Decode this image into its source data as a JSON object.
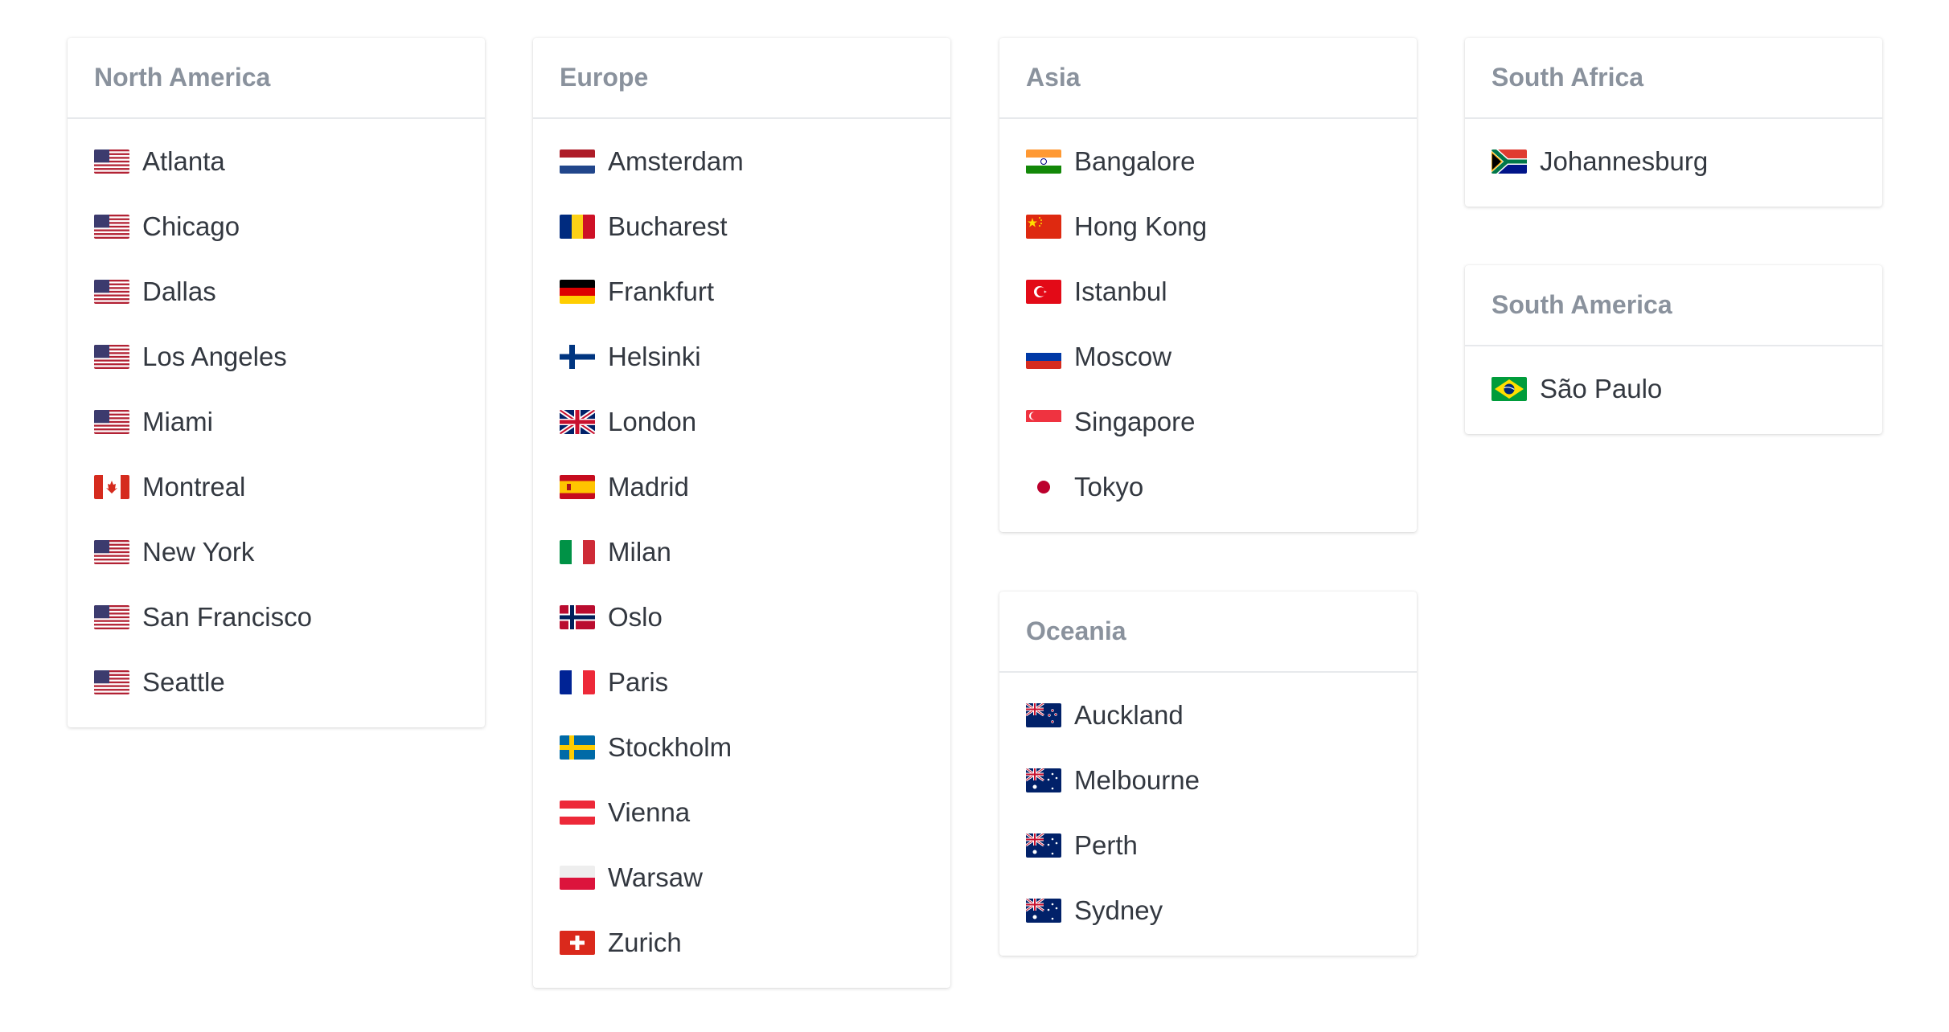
{
  "regions": [
    {
      "key": "north-america",
      "title": "North America",
      "locations": [
        {
          "name": "Atlanta",
          "flag": "us"
        },
        {
          "name": "Chicago",
          "flag": "us"
        },
        {
          "name": "Dallas",
          "flag": "us"
        },
        {
          "name": "Los Angeles",
          "flag": "us"
        },
        {
          "name": "Miami",
          "flag": "us"
        },
        {
          "name": "Montreal",
          "flag": "ca"
        },
        {
          "name": "New York",
          "flag": "us"
        },
        {
          "name": "San Francisco",
          "flag": "us"
        },
        {
          "name": "Seattle",
          "flag": "us"
        }
      ]
    },
    {
      "key": "europe",
      "title": "Europe",
      "locations": [
        {
          "name": "Amsterdam",
          "flag": "nl"
        },
        {
          "name": "Bucharest",
          "flag": "ro"
        },
        {
          "name": "Frankfurt",
          "flag": "de"
        },
        {
          "name": "Helsinki",
          "flag": "fi"
        },
        {
          "name": "London",
          "flag": "gb"
        },
        {
          "name": "Madrid",
          "flag": "es"
        },
        {
          "name": "Milan",
          "flag": "it"
        },
        {
          "name": "Oslo",
          "flag": "no"
        },
        {
          "name": "Paris",
          "flag": "fr"
        },
        {
          "name": "Stockholm",
          "flag": "se"
        },
        {
          "name": "Vienna",
          "flag": "at"
        },
        {
          "name": "Warsaw",
          "flag": "pl"
        },
        {
          "name": "Zurich",
          "flag": "ch"
        }
      ]
    },
    {
      "key": "asia",
      "title": "Asia",
      "locations": [
        {
          "name": "Bangalore",
          "flag": "in"
        },
        {
          "name": "Hong Kong",
          "flag": "cn"
        },
        {
          "name": "Istanbul",
          "flag": "tr"
        },
        {
          "name": "Moscow",
          "flag": "ru"
        },
        {
          "name": "Singapore",
          "flag": "sg"
        },
        {
          "name": "Tokyo",
          "flag": "jp"
        }
      ]
    },
    {
      "key": "oceania",
      "title": "Oceania",
      "locations": [
        {
          "name": "Auckland",
          "flag": "nz"
        },
        {
          "name": "Melbourne",
          "flag": "au"
        },
        {
          "name": "Perth",
          "flag": "au"
        },
        {
          "name": "Sydney",
          "flag": "au"
        }
      ]
    },
    {
      "key": "south-africa",
      "title": "South Africa",
      "locations": [
        {
          "name": "Johannesburg",
          "flag": "za"
        }
      ]
    },
    {
      "key": "south-america",
      "title": "South America",
      "locations": [
        {
          "name": "São Paulo",
          "flag": "br"
        }
      ]
    }
  ],
  "colors": {
    "title": "#8a929d",
    "text": "#333840",
    "divider": "#e7e9ec"
  }
}
